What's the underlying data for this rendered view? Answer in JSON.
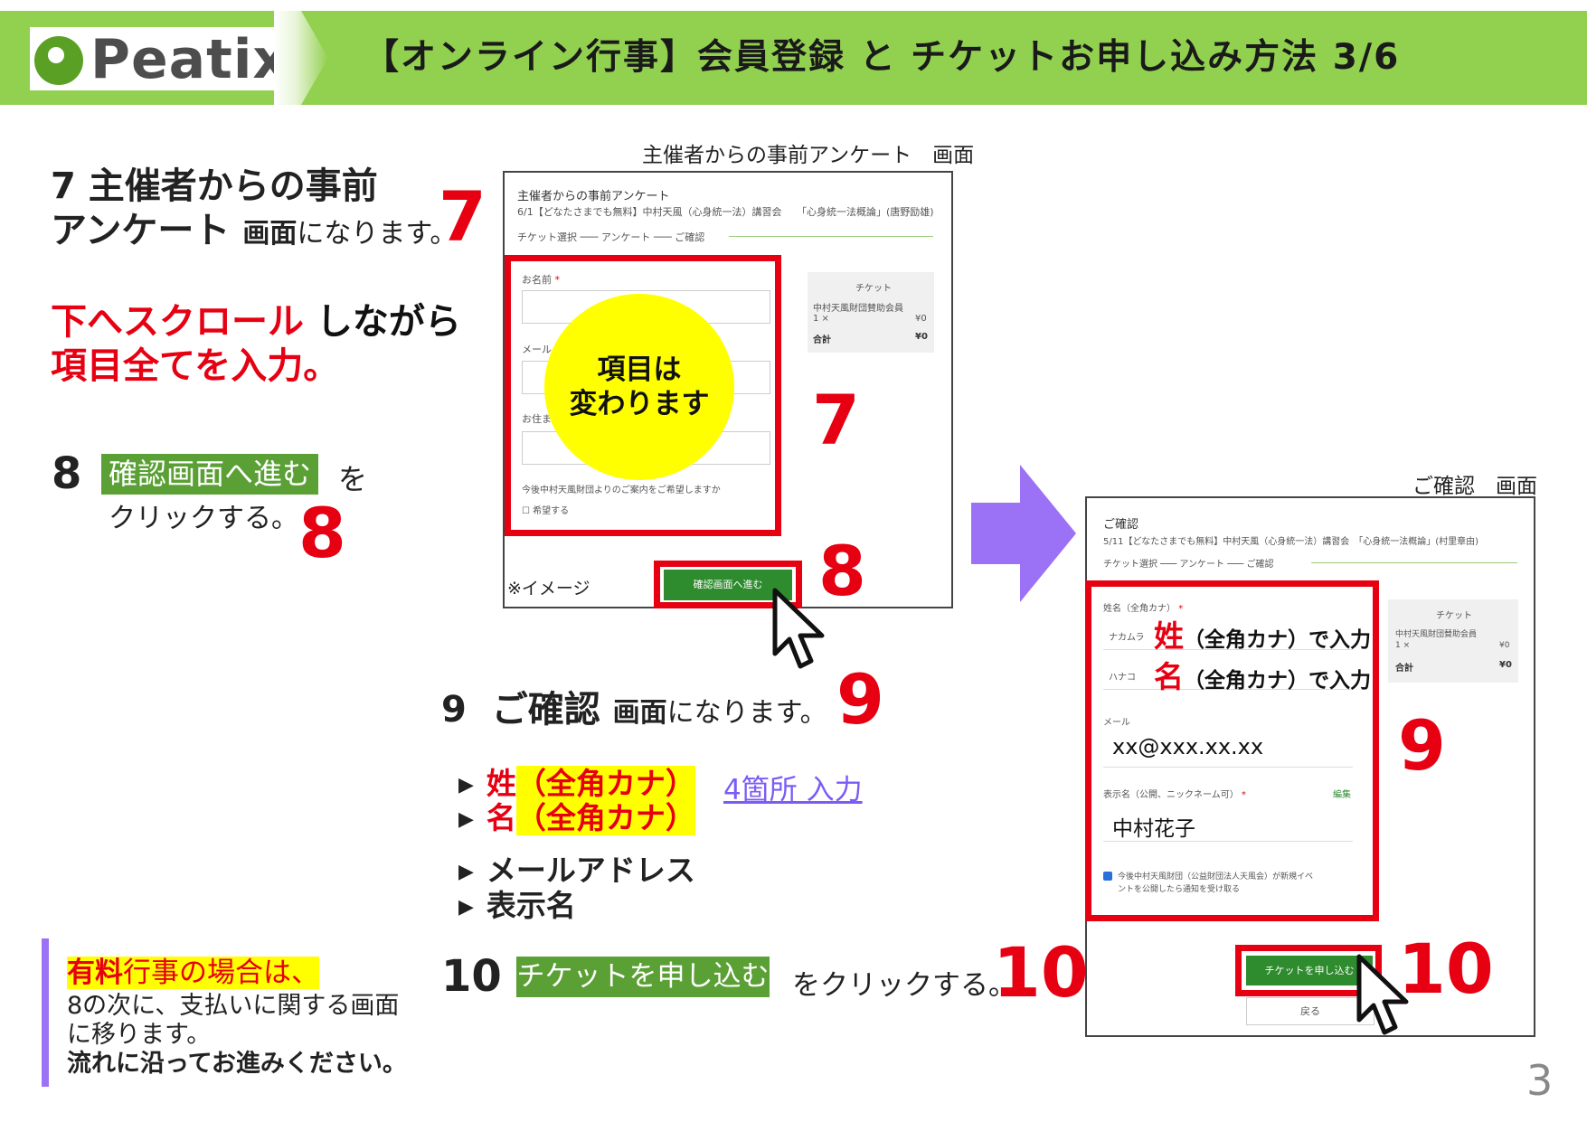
{
  "header": {
    "logo": "Peatix",
    "title": "【オンライン行事】会員登録 と チケットお申し込み方法 3/6"
  },
  "step7": {
    "num": "7",
    "title_l1": "主催者からの事前",
    "title_l2": "アンケート",
    "screen_word": "画面",
    "suffix": "になります。",
    "big_num": "7"
  },
  "scroll": {
    "red1": "下へスクロール",
    "text1": " しながら",
    "red2": "項目全て",
    "text2": "を入力。"
  },
  "step8": {
    "num": "8",
    "button": "確認画面へ進む",
    "wo": "を",
    "line2": "クリックする。",
    "big_num": "8"
  },
  "screen1": {
    "caption": "主催者からの事前アンケート　画面",
    "heading": "主催者からの事前アンケート",
    "subheading": "6/1【どなたさまでも無料】中村天風（心身統一法）講習会　　「心身統一法概論」(唐野励雄)",
    "steps": "チケット選択 ─── アンケート ─── ご確認",
    "field1_label": "お名前 ",
    "required": "*",
    "field2_label": "メール",
    "field3_label": "お住ま",
    "question": "今後中村天風財団よりのご案内をご希望しますか",
    "checkbox": "☐ 希望する",
    "ticket_head": "チケット",
    "ticket_item": "中村天風財団賛助会員",
    "ticket_qty": "1 ×",
    "ticket_price": "¥0",
    "total_label": "合計",
    "total_value": "¥0",
    "circle_l1": "項目は",
    "circle_l2": "変わります",
    "big7": "7",
    "note": "※イメージ",
    "confirm_btn": "確認画面へ進む",
    "big8": "8"
  },
  "screen2": {
    "caption": "ご確認　画面",
    "heading": "ご確認",
    "subheading": "5/11【どなたさまでも無料】中村天風（心身統一法）講習会　「心身統一法概論」(村里章由)",
    "steps": "チケット選択 ─── アンケート ─── ご確認",
    "name_label": "姓名（全角カナ）",
    "required": "*",
    "sei_placeholder": "ナカムラ",
    "mei_placeholder": "ハナコ",
    "sei_kanji": "姓",
    "mei_kanji": "名",
    "kana_hint": "（全角カナ）で入力",
    "mail_label": "メール",
    "mail_value": "xx@xxx.xx.xx",
    "display_label": "表示名（公開、ニックネーム可）",
    "edit_link": "編集",
    "display_value": "中村花子",
    "check_text_l1": "今後中村天風財団（公益財団法人天風会）が新規イベ",
    "check_text_l2": "ントを公開したら通知を受け取る",
    "ticket_head": "チケット",
    "ticket_item": "中村天風財団賛助会員",
    "ticket_qty": "1 ×",
    "ticket_price": "¥0",
    "total_label": "合計",
    "total_value": "¥0",
    "big9": "9",
    "apply_btn": "チケットを申し込む",
    "back_btn": "戻る",
    "big10": "10"
  },
  "step9": {
    "num": "9",
    "title": "ご確認",
    "screen_word": "画面",
    "suffix": "になります。",
    "big_num": "9",
    "b1_red": "姓",
    "b1_hl": "（全角カナ）",
    "b2_red": "名",
    "b2_hl": "（全角カナ）",
    "b3": "メールアドレス",
    "b4": "表示名",
    "four_places": "4箇所 入力"
  },
  "step10": {
    "num": "10",
    "button": "チケットを申し込む",
    "text": "をクリックする。",
    "big_num": "10"
  },
  "note": {
    "red": "有料",
    "rest": "行事の場合は、",
    "l2": "8の次に、支払いに関する画面",
    "l3": "に移ります。",
    "l4": "流れに沿ってお進みください。"
  },
  "page_number": "3",
  "colors": {
    "header_green": "#92d050",
    "accent_red": "#e60012",
    "button_green": "#5aa035",
    "arrow_purple": "#9b72f5",
    "highlight_yellow": "#ffff00"
  }
}
